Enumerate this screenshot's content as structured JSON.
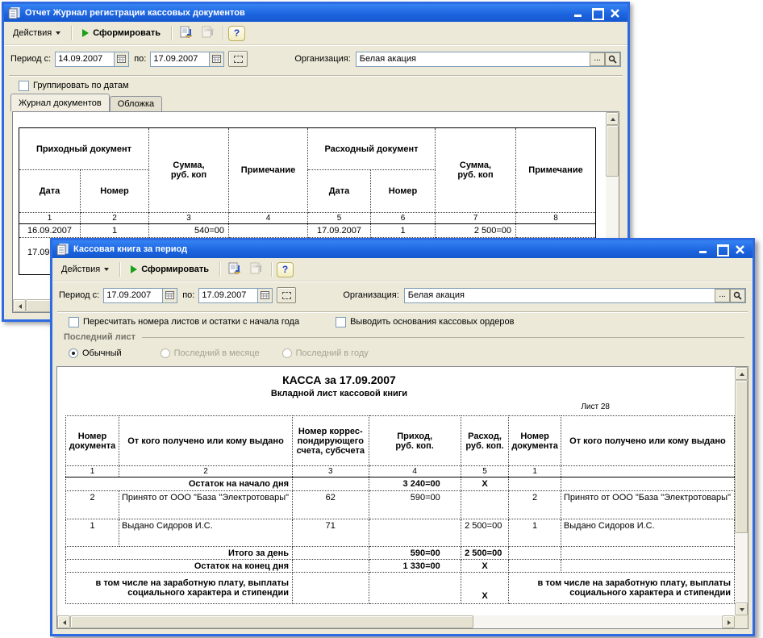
{
  "back_window": {
    "title": "Отчет Журнал регистрации кассовых документов",
    "toolbar": {
      "actions": "Действия",
      "generate": "Сформировать",
      "help": "?"
    },
    "params": {
      "period_from_label": "Период с:",
      "period_from": "14.09.2007",
      "period_to_label": "по:",
      "period_to": "17.09.2007",
      "org_label": "Организация:",
      "org": "Белая акация",
      "org_select": "..."
    },
    "group_by_dates_label": "Группировать по датам",
    "tabs": {
      "documents": "Журнал документов",
      "cover": "Обложка"
    },
    "table": {
      "prihod_group": "Приходный документ",
      "rashod_group": "Расходный документ",
      "summa": "Сумма,\nруб. коп",
      "primechanie": "Примечание",
      "date_col": "Дата",
      "num_col": "Номер",
      "nums": [
        "1",
        "2",
        "3",
        "4",
        "5",
        "6",
        "7",
        "8"
      ],
      "row1": [
        "16.09.2007",
        "1",
        "540=00",
        "",
        "17.09.2007",
        "1",
        "2 500=00",
        ""
      ],
      "row2": [
        "17.09.2007",
        "",
        "",
        "",
        "",
        "",
        "",
        ""
      ]
    }
  },
  "front_window": {
    "title": "Кассовая книга за период",
    "toolbar": {
      "actions": "Действия",
      "generate": "Сформировать",
      "help": "?"
    },
    "params": {
      "period_from_label": "Период с:",
      "period_from": "17.09.2007",
      "period_to_label": "по:",
      "period_to": "17.09.2007",
      "org_label": "Организация:",
      "org": "Белая акация",
      "org_select": "..."
    },
    "recalc_label": "Пересчитать номера листов и остатки с начала года",
    "basis_label": "Выводить основания кассовых ордеров",
    "last_sheet_label": "Последний лист",
    "radio_normal": "Обычный",
    "radio_last_month": "Последний в месяце",
    "radio_last_year": "Последний в году",
    "report": {
      "title": "КАССА за 17.09.2007",
      "subtitle": "Вкладной лист кассовой книги",
      "sheet": "Лист 28",
      "h_doc_num": "Номер\nдокумента",
      "h_counterparty": "От кого получено или кому выдано",
      "h_corr_account": "Номер коррес-\nпондирующего\nсчета, субсчета",
      "h_prihod": "Приход,\nруб. коп.",
      "h_rashod": "Расход,\nруб. коп.",
      "nums": [
        "1",
        "2",
        "3",
        "4",
        "5",
        "1",
        ""
      ],
      "opening_label": "Остаток на начало дня",
      "opening_value": "3 240=00",
      "x_marker": "X",
      "row1": {
        "num": "2",
        "descr": "Принято от ООО \"База \"Электротовары\"",
        "account": "62",
        "prihod": "590=00",
        "rashod": ""
      },
      "row2": {
        "num": "1",
        "descr": "Выдано Сидоров И.С.",
        "account": "71",
        "prihod": "",
        "rashod": "2 500=00"
      },
      "total_label": "Итого за день",
      "total_prihod": "590=00",
      "total_rashod": "2 500=00",
      "closing_label": "Остаток на конец дня",
      "closing_value": "1 330=00",
      "incl_label": "в том числе на заработную плату, выплаты\nсоциального характера и стипендии"
    }
  }
}
